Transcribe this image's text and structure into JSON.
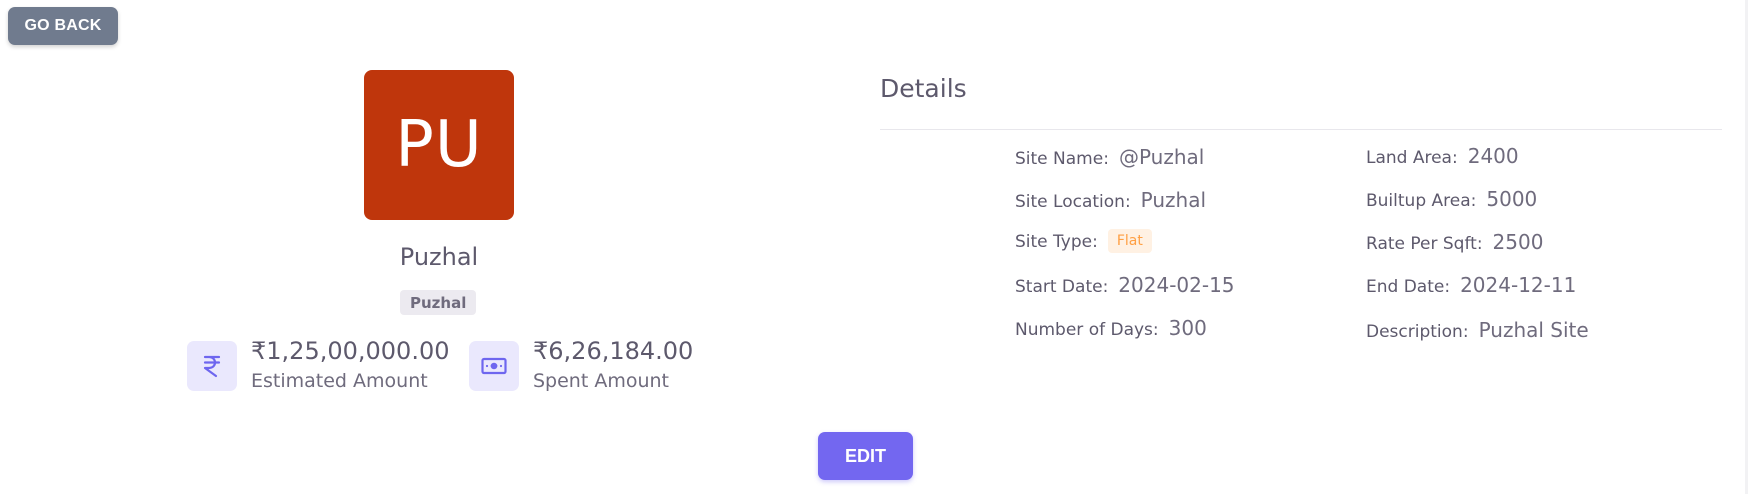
{
  "header": {
    "go_back_label": "GO BACK"
  },
  "profile": {
    "avatar_initials": "PU",
    "avatar_color": "#bf360c",
    "name": "Puzhal",
    "badge": "Puzhal"
  },
  "stats": [
    {
      "icon": "rupee-icon",
      "value": "₹1,25,00,000.00",
      "label": "Estimated Amount"
    },
    {
      "icon": "money-icon",
      "value": "₹6,26,184.00",
      "label": "Spent Amount"
    }
  ],
  "details": {
    "title": "Details",
    "fields": {
      "site_name": {
        "label": "Site Name:",
        "value": "@Puzhal"
      },
      "site_location": {
        "label": "Site Location:",
        "value": "Puzhal"
      },
      "site_type": {
        "label": "Site Type:",
        "value": "Flat"
      },
      "start_date": {
        "label": "Start Date:",
        "value": "2024-02-15"
      },
      "number_of_days": {
        "label": "Number of Days:",
        "value": "300"
      },
      "land_area": {
        "label": "Land Area:",
        "value": "2400"
      },
      "builtup_area": {
        "label": "Builtup Area:",
        "value": "5000"
      },
      "rate_per_sqft": {
        "label": "Rate Per Sqft:",
        "value": "2500"
      },
      "end_date": {
        "label": "End Date:",
        "value": "2024-12-11"
      },
      "description": {
        "label": "Description:",
        "value": "Puzhal Site"
      }
    }
  },
  "actions": {
    "edit_label": "EDIT"
  },
  "colors": {
    "primary": "#7367f0",
    "secondary": "#707b8e",
    "warning": "#ff9f43",
    "icon_bg": "#eae8fd"
  }
}
